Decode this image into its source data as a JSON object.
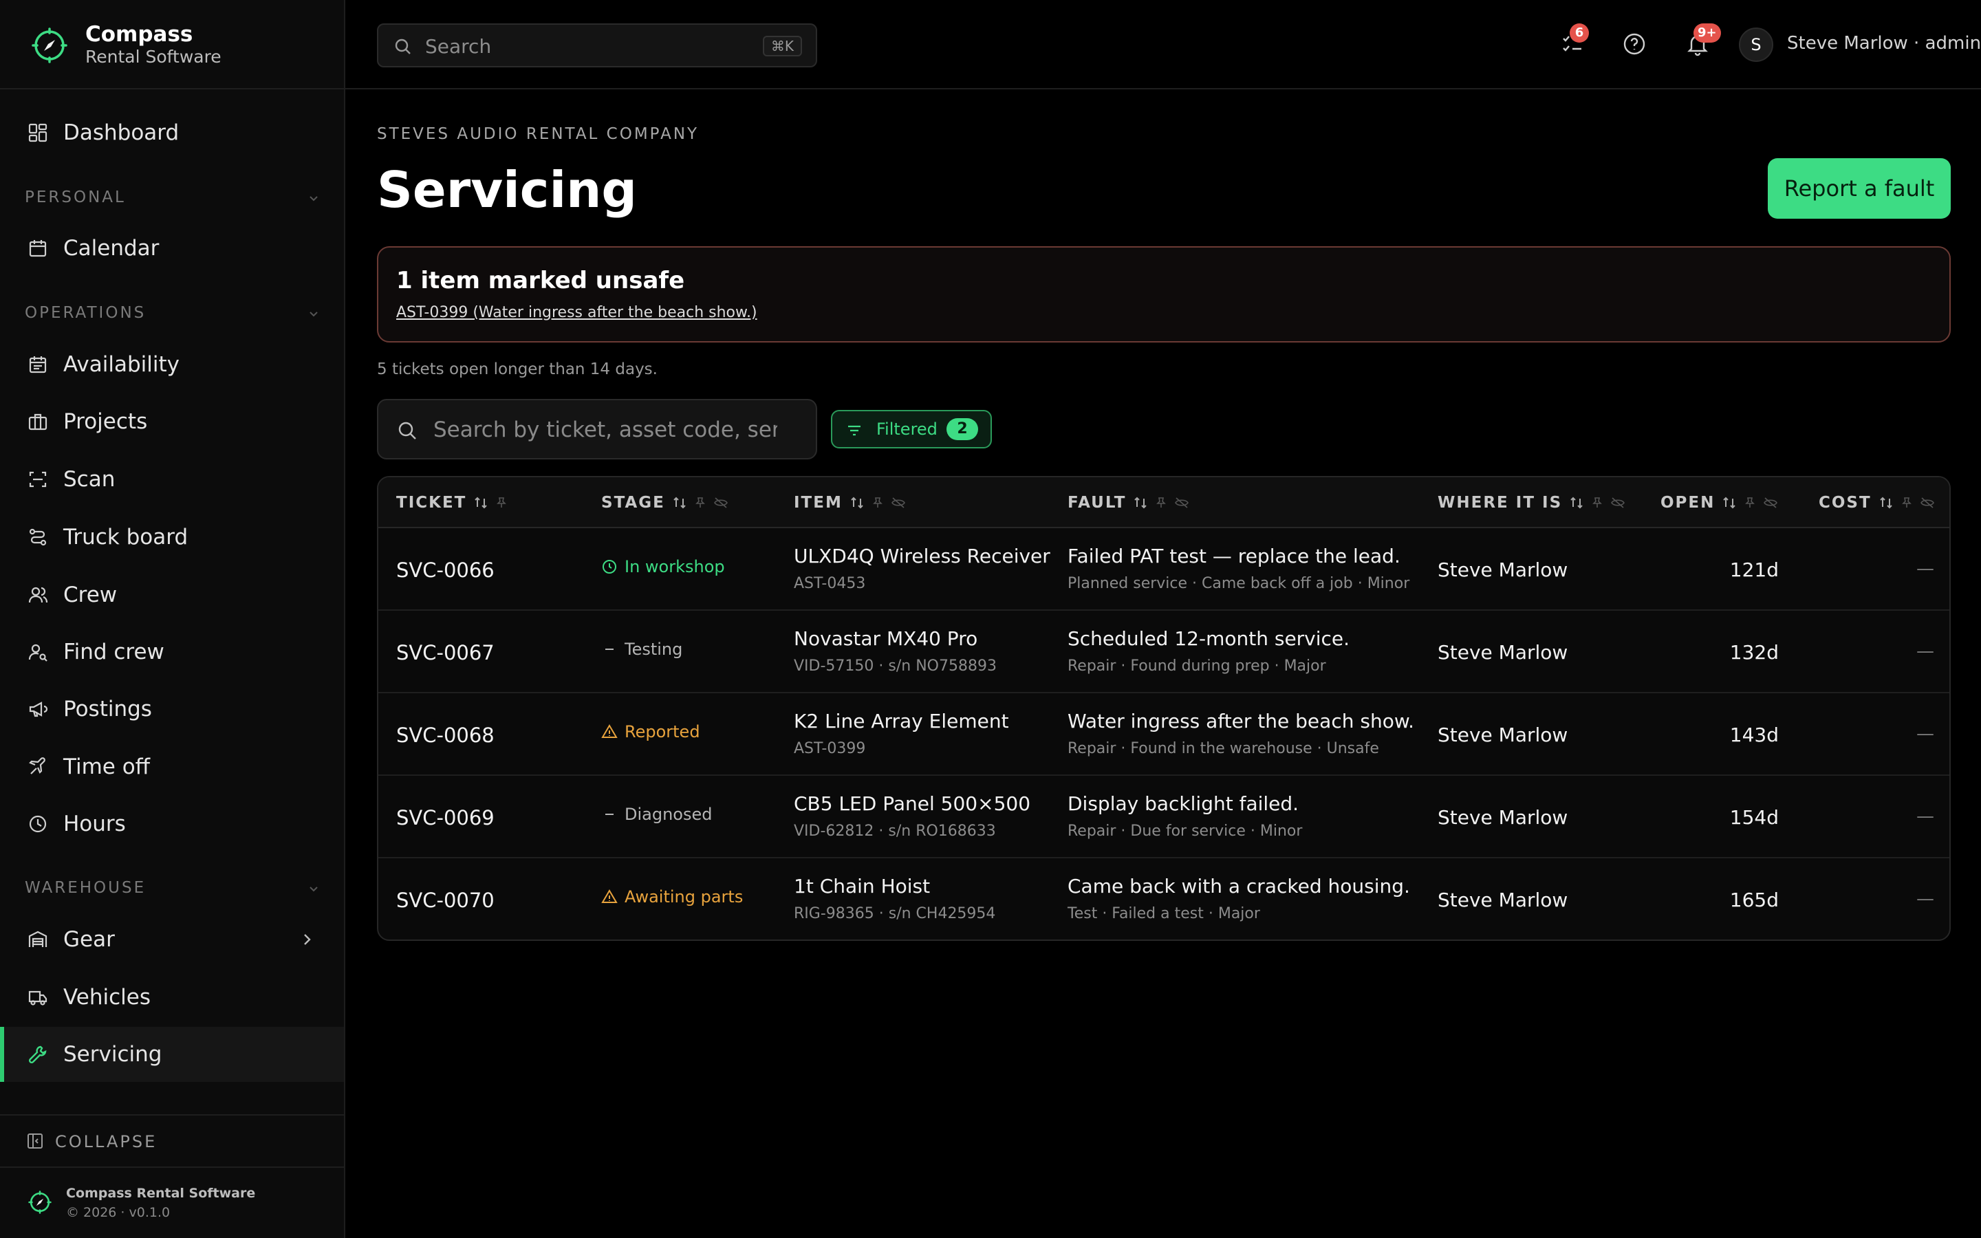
{
  "brand": {
    "name": "Compass",
    "subtitle": "Rental Software"
  },
  "sidebar": {
    "dashboard": "Dashboard",
    "sections": [
      {
        "label": "PERSONAL"
      },
      {
        "label": "OPERATIONS"
      },
      {
        "label": "WAREHOUSE"
      }
    ],
    "items": [
      {
        "label": "Calendar",
        "icon": "calendar-icon"
      },
      {
        "label": "Availability",
        "icon": "calendar-check-icon"
      },
      {
        "label": "Projects",
        "icon": "briefcase-icon"
      },
      {
        "label": "Scan",
        "icon": "scan-icon"
      },
      {
        "label": "Truck board",
        "icon": "route-icon"
      },
      {
        "label": "Crew",
        "icon": "users-icon"
      },
      {
        "label": "Find crew",
        "icon": "user-search-icon"
      },
      {
        "label": "Postings",
        "icon": "megaphone-icon"
      },
      {
        "label": "Time off",
        "icon": "plane-icon"
      },
      {
        "label": "Hours",
        "icon": "clock-icon"
      },
      {
        "label": "Gear",
        "icon": "warehouse-icon"
      },
      {
        "label": "Vehicles",
        "icon": "truck-icon"
      },
      {
        "label": "Servicing",
        "icon": "wrench-icon"
      }
    ],
    "active_item": "Servicing",
    "collapse_label": "COLLAPSE",
    "footer_name": "Compass Rental Software",
    "footer_version": "© 2026 · v0.1.0"
  },
  "topbar": {
    "search_placeholder": "Search",
    "search_shortcut": "⌘K",
    "tasks_badge": "6",
    "notifications_badge": "9+",
    "avatar_initial": "S",
    "user_label": "Steve Marlow · admin"
  },
  "page": {
    "company": "STEVES AUDIO RENTAL COMPANY",
    "title": "Servicing",
    "report_button": "Report a fault",
    "alert_title": "1 item marked unsafe",
    "alert_link": "AST-0399 (Water ingress after the beach show.)",
    "note": "5 tickets open longer than 14 days.",
    "table_search_placeholder": "Search by ticket, asset code, serial, fault…",
    "filter_label": "Filtered",
    "filter_count": "2"
  },
  "table": {
    "columns": [
      "TICKET",
      "STAGE",
      "ITEM",
      "FAULT",
      "WHERE IT IS",
      "OPEN",
      "COST"
    ],
    "rows": [
      {
        "ticket": "SVC-0066",
        "stage": "In workshop",
        "stage_kind": "workshop",
        "item": "ULXD4Q Wireless Receiver",
        "item_sub": "AST-0453",
        "fault": "Failed PAT test — replace the lead.",
        "fault_sub": "Planned service · Came back off a job · Minor",
        "where": "Steve Marlow",
        "open": "121d",
        "cost": "—"
      },
      {
        "ticket": "SVC-0067",
        "stage": "Testing",
        "stage_kind": "neutral",
        "item": "Novastar MX40 Pro",
        "item_sub": "VID-57150 · s/n NO758893",
        "fault": "Scheduled 12-month service.",
        "fault_sub": "Repair · Found during prep · Major",
        "where": "Steve Marlow",
        "open": "132d",
        "cost": "—"
      },
      {
        "ticket": "SVC-0068",
        "stage": "Reported",
        "stage_kind": "warning",
        "item": "K2 Line Array Element",
        "item_sub": "AST-0399",
        "fault": "Water ingress after the beach show.",
        "fault_sub": "Repair · Found in the warehouse · Unsafe",
        "where": "Steve Marlow",
        "open": "143d",
        "cost": "—"
      },
      {
        "ticket": "SVC-0069",
        "stage": "Diagnosed",
        "stage_kind": "neutral",
        "item": "CB5 LED Panel 500×500",
        "item_sub": "VID-62812 · s/n RO168633",
        "fault": "Display backlight failed.",
        "fault_sub": "Repair · Due for service · Minor",
        "where": "Steve Marlow",
        "open": "154d",
        "cost": "—"
      },
      {
        "ticket": "SVC-0070",
        "stage": "Awaiting parts",
        "stage_kind": "warning",
        "item": "1t Chain Hoist",
        "item_sub": "RIG-98365 · s/n CH425954",
        "fault": "Came back with a cracked housing.",
        "fault_sub": "Test · Failed a test · Major",
        "where": "Steve Marlow",
        "open": "165d",
        "cost": "—"
      }
    ]
  },
  "colors": {
    "accent": "#3ddc84",
    "warning": "#e8a33d",
    "danger_border": "#6b3a34",
    "badge": "#e5534b",
    "neutral_stage": "#b5b5b5"
  }
}
